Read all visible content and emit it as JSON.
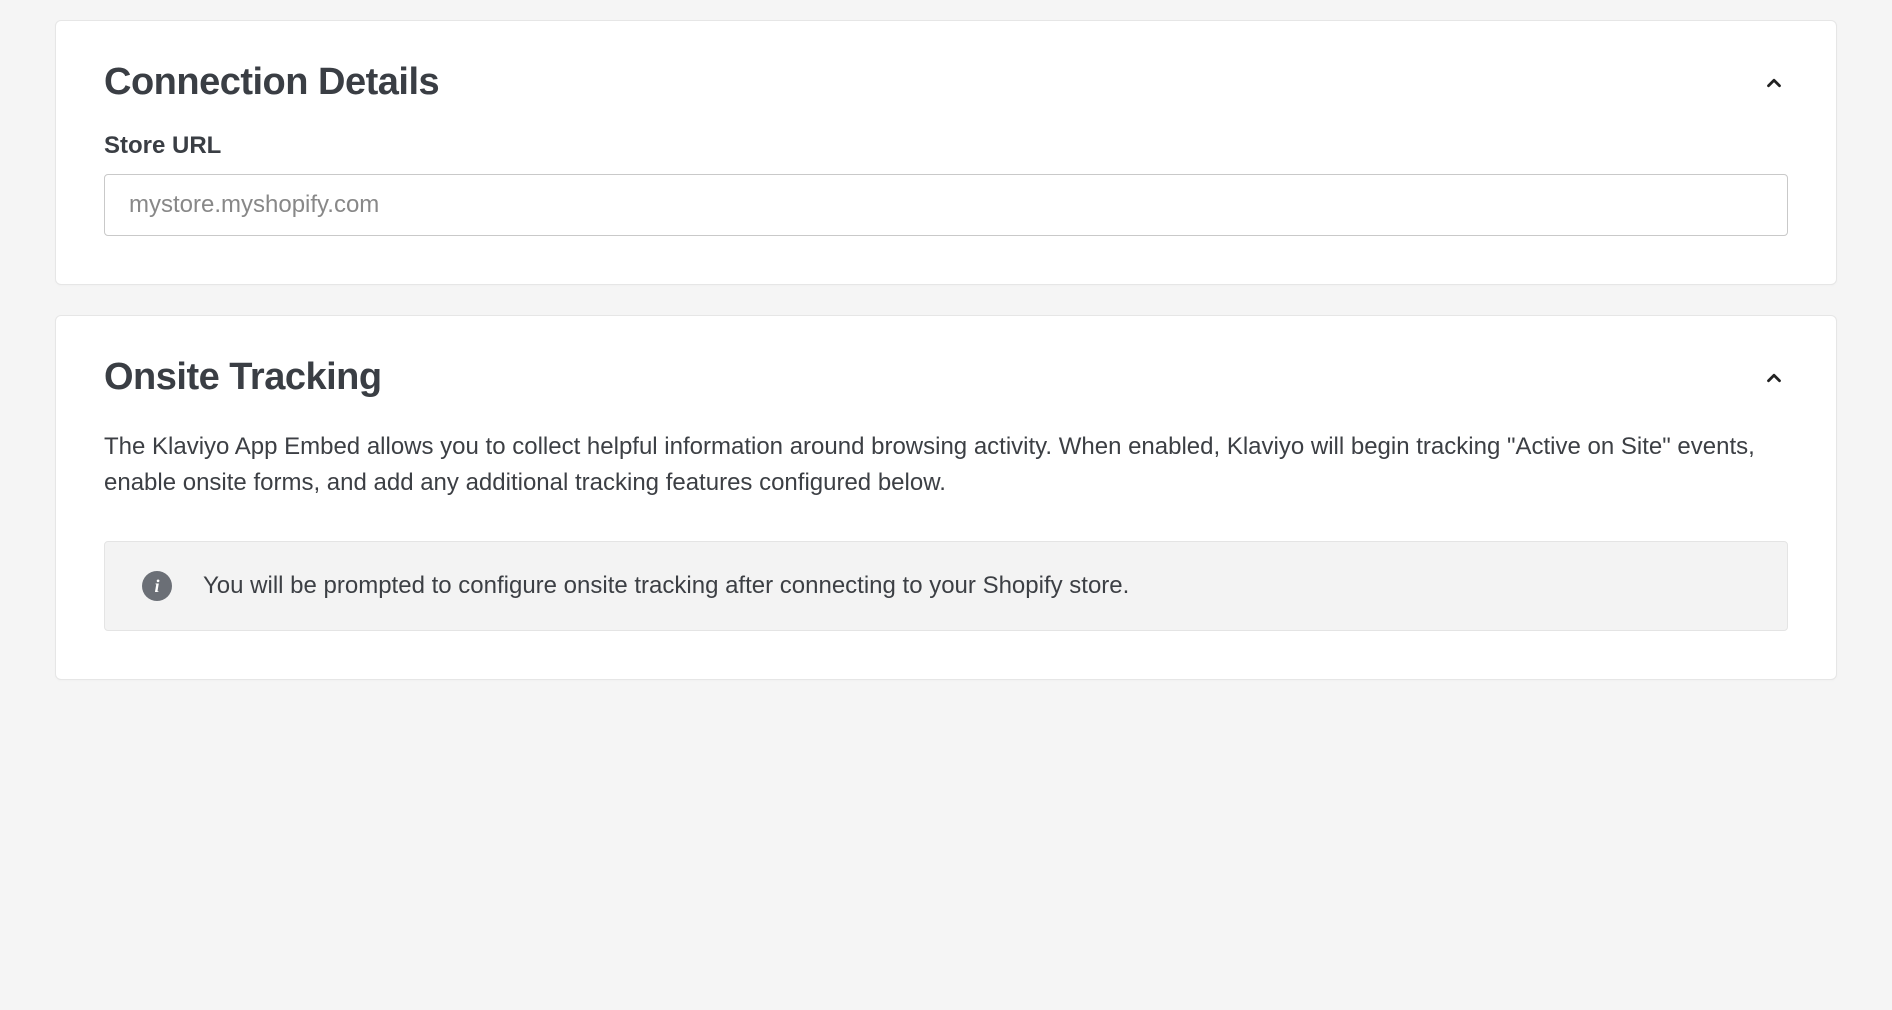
{
  "connection_details": {
    "title": "Connection Details",
    "store_url_label": "Store URL",
    "store_url_placeholder": "mystore.myshopify.com"
  },
  "onsite_tracking": {
    "title": "Onsite Tracking",
    "description": "The Klaviyo App Embed allows you to collect helpful information around browsing activity. When enabled, Klaviyo will begin tracking \"Active on Site\" events, enable onsite forms, and add any additional tracking features configured below.",
    "info_message": "You will be prompted to configure onsite tracking after connecting to your Shopify store.",
    "info_glyph": "i"
  }
}
